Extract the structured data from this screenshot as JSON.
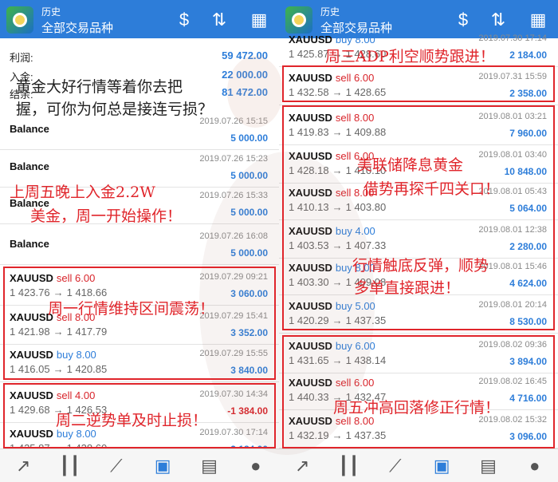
{
  "app": {
    "title": "历史",
    "subtitle": "全部交易品种"
  },
  "left": {
    "profit_label": "利润:",
    "profit_value": "59 472.00",
    "deposit_label": "入金:",
    "deposit_value": "22 000.00",
    "balance_label": "结余:",
    "balance_value": "81 472.00",
    "rows": [
      {
        "kind": "balance",
        "label": "Balance",
        "date": "2019.07.26 15:15",
        "amount": "5 000.00"
      },
      {
        "kind": "balance",
        "label": "Balance",
        "date": "2019.07.26 15:23",
        "amount": "5 000.00"
      },
      {
        "kind": "balance",
        "label": "Balance",
        "date": "2019.07.26 15:33",
        "amount": "5 000.00"
      },
      {
        "kind": "balance",
        "label": "Balance",
        "date": "2019.07.26 16:08",
        "amount": "5 000.00"
      },
      {
        "kind": "trade",
        "symbol": "XAUUSD",
        "side": "sell",
        "lots": "sell 6.00",
        "open": "1 423.76",
        "close": "1 418.66",
        "date": "2019.07.29 09:21",
        "profit": "3 060.00"
      },
      {
        "kind": "trade",
        "symbol": "XAUUSD",
        "side": "sell",
        "lots": "sell 8.00",
        "open": "1 421.98",
        "close": "1 417.79",
        "date": "2019.07.29 15:41",
        "profit": "3 352.00"
      },
      {
        "kind": "trade",
        "symbol": "XAUUSD",
        "side": "buy",
        "lots": "buy 8.00",
        "open": "1 416.05",
        "close": "1 420.85",
        "date": "2019.07.29 15:55",
        "profit": "3 840.00"
      },
      {
        "kind": "trade",
        "symbol": "XAUUSD",
        "side": "sell",
        "lots": "sell 4.00",
        "open": "1 429.68",
        "close": "1 426.53",
        "date": "2019.07.30 14:34",
        "profit": "-1 384.00"
      },
      {
        "kind": "trade",
        "symbol": "XAUUSD",
        "side": "buy",
        "lots": "buy 8.00",
        "open": "1 425.87",
        "close": "1 428.60",
        "date": "2019.07.30 17:14",
        "profit": "2 184.00"
      }
    ]
  },
  "right": {
    "rows": [
      {
        "symbol": "XAUUSD",
        "side": "buy",
        "lots": "buy 8.00",
        "open": "1 425.87",
        "close": "1 428.60",
        "date": "2019.07.30 17:14",
        "profit": "2 184.00"
      },
      {
        "symbol": "XAUUSD",
        "side": "sell",
        "lots": "sell 6.00",
        "open": "1 432.58",
        "close": "1 428.65",
        "date": "2019.07.31 15:59",
        "profit": "2 358.00"
      },
      {
        "symbol": "XAUUSD",
        "side": "sell",
        "lots": "sell 8.00",
        "open": "1 419.83",
        "close": "1 409.88",
        "date": "2019.08.01 03:21",
        "profit": "7 960.00"
      },
      {
        "symbol": "XAUUSD",
        "side": "sell",
        "lots": "sell 6.00",
        "open": "1 428.18",
        "close": "1 410.10",
        "date": "2019.08.01 03:40",
        "profit": "10 848.00"
      },
      {
        "symbol": "XAUUSD",
        "side": "sell",
        "lots": "sell 8.00",
        "open": "1 410.13",
        "close": "1 403.80",
        "date": "2019.08.01 05:43",
        "profit": "5 064.00"
      },
      {
        "symbol": "XAUUSD",
        "side": "buy",
        "lots": "buy 4.00",
        "open": "1 403.53",
        "close": "1 407.33",
        "date": "2019.08.01 12:38",
        "profit": "2 280.00"
      },
      {
        "symbol": "XAUUSD",
        "side": "buy",
        "lots": "buy 8.00",
        "open": "1 403.30",
        "close": "1 409.08",
        "date": "2019.08.01 15:46",
        "profit": "4 624.00"
      },
      {
        "symbol": "XAUUSD",
        "side": "buy",
        "lots": "buy 5.00",
        "open": "1 420.29",
        "close": "1 437.35",
        "date": "2019.08.01 20:14",
        "profit": "8 530.00"
      },
      {
        "symbol": "XAUUSD",
        "side": "buy",
        "lots": "buy 6.00",
        "open": "1 431.65",
        "close": "1 438.14",
        "date": "2019.08.02 09:36",
        "profit": "3 894.00"
      },
      {
        "symbol": "XAUUSD",
        "side": "sell",
        "lots": "sell 6.00",
        "open": "1 440.33",
        "close": "1 432.47",
        "date": "2019.08.02 16:45",
        "profit": "4 716.00"
      },
      {
        "symbol": "XAUUSD",
        "side": "sell",
        "lots": "sell 8.00",
        "open": "1 432.19",
        "close": "1 437.35",
        "date": "2019.08.02 15:32",
        "profit": "3 096.00"
      }
    ]
  },
  "notes": {
    "intro_1": "黄金大好行情等着你去把",
    "intro_2": "握，可你为何总是接连亏损？",
    "friday_1": "上周五晚上入金2.2W",
    "friday_2": "美金，周一开始操作！",
    "monday": "周一行情维持区间震荡！",
    "tuesday": "周二逆势单及时止损！",
    "wednesday": "周三ADP利空顺势跟进！",
    "fed_1": "美联储降息黄金",
    "fed_2": "借势再探千四关口！",
    "rebound_1": "行情触底反弹，顺势",
    "rebound_2": "多单直接跟进！",
    "friday_end": "周五冲高回落修正行情！"
  },
  "tabs": [
    "trade-icon",
    "chart-icon",
    "indicator-icon",
    "history-icon",
    "news-icon",
    "chat-icon"
  ],
  "colors": {
    "accent": "#2d7dd9",
    "sell": "#d8232a",
    "box": "#e0252b"
  }
}
